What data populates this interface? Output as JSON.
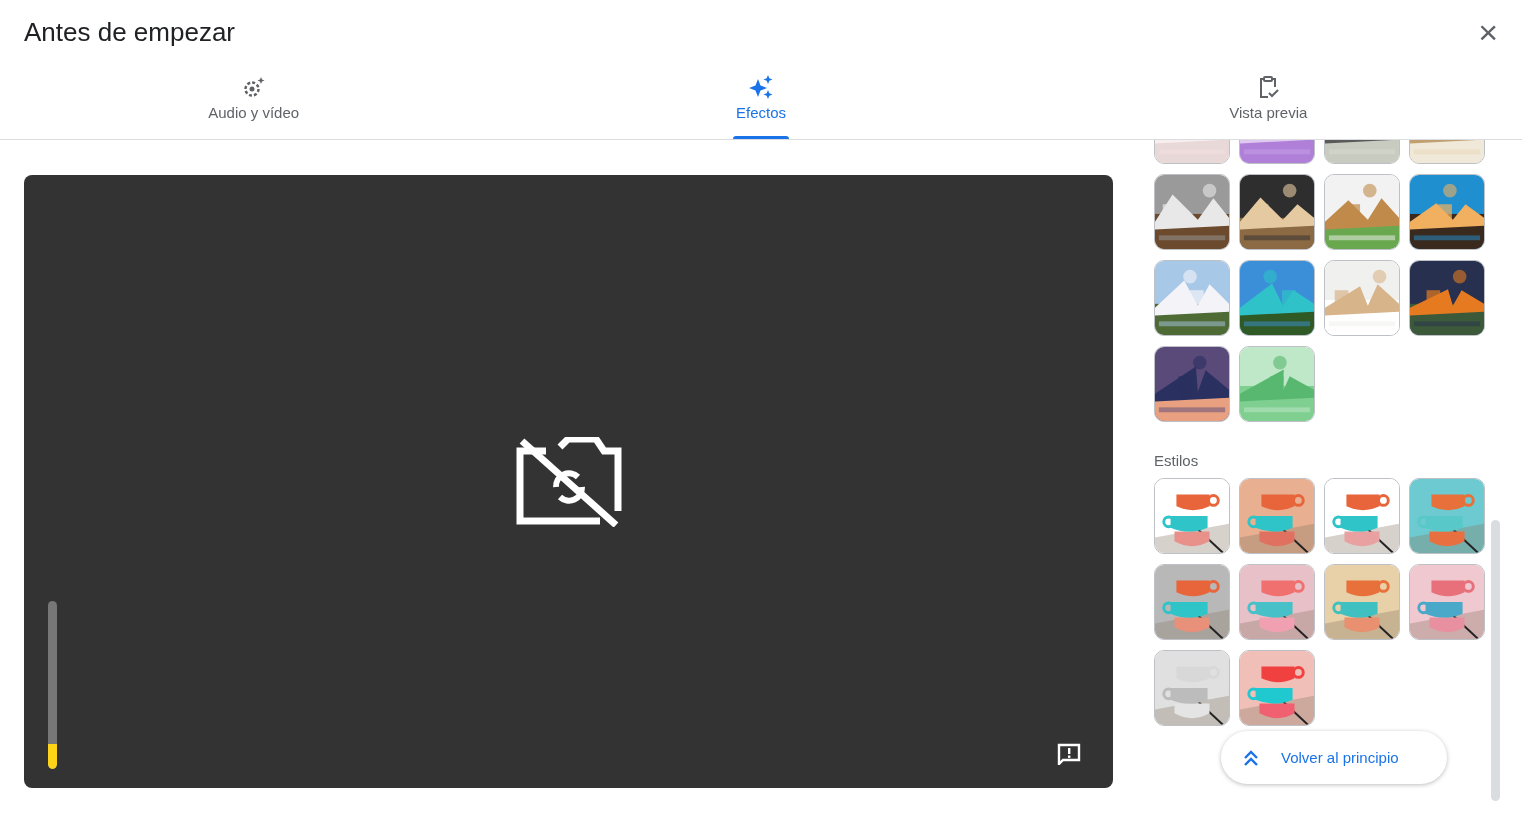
{
  "dialog": {
    "title": "Antes de empezar",
    "close_label": "×"
  },
  "tabs": [
    {
      "label": "Audio y vídeo",
      "selected": false
    },
    {
      "label": "Efectos",
      "selected": true
    },
    {
      "label": "Vista previa",
      "selected": false
    }
  ],
  "preview": {
    "mic": {
      "level": 0.15
    }
  },
  "styles": {
    "heading": "Estilos"
  },
  "back_to_top": {
    "label": "Volver al principio"
  }
}
